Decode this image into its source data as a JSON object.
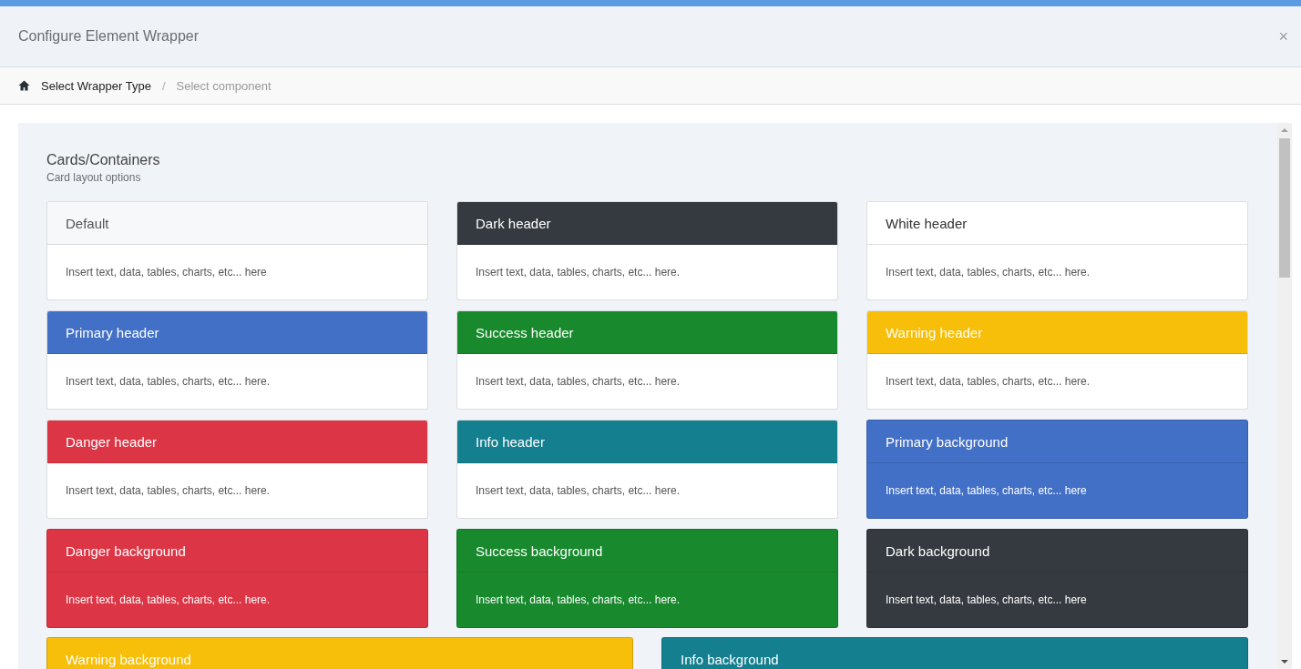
{
  "window": {
    "title": "Configure Element Wrapper",
    "close": "×"
  },
  "breadcrumb_separator": "/",
  "breadcrumb": [
    {
      "label": "Select Wrapper Type",
      "selected": false
    },
    {
      "label": "Select component",
      "selected": true
    }
  ],
  "section": {
    "title": "Cards/Containers",
    "subtitle": "Card layout options"
  },
  "cards": [
    {
      "title": "Default",
      "body": "Insert text, data, tables, charts, etc... here",
      "kind": "default",
      "color": "#f7f8fa"
    },
    {
      "title": "Dark header",
      "body": "Insert text, data, tables, charts, etc... here.",
      "kind": "header",
      "color": "#343a40"
    },
    {
      "title": "White header",
      "body": "Insert text, data, tables, charts, etc... here.",
      "kind": "header",
      "color": "#ffffff"
    },
    {
      "title": "Primary header",
      "body": "Insert text, data, tables, charts, etc... here.",
      "kind": "header",
      "color": "#4270c6"
    },
    {
      "title": "Success header",
      "body": "Insert text, data, tables, charts, etc... here.",
      "kind": "header",
      "color": "#18892d"
    },
    {
      "title": "Warning header",
      "body": "Insert text, data, tables, charts, etc... here.",
      "kind": "header",
      "color": "#f7be0a"
    },
    {
      "title": "Danger header",
      "body": "Insert text, data, tables, charts, etc... here.",
      "kind": "header",
      "color": "#dc3545"
    },
    {
      "title": "Info header",
      "body": "Insert text, data, tables, charts, etc... here.",
      "kind": "header",
      "color": "#137f8f"
    },
    {
      "title": "Primary background",
      "body": "Insert text, data, tables, charts, etc... here",
      "kind": "background",
      "color": "#4270c6"
    },
    {
      "title": "Danger background",
      "body": "Insert text, data, tables, charts, etc... here.",
      "kind": "background",
      "color": "#dc3545"
    },
    {
      "title": "Success background",
      "body": "Insert text, data, tables, charts, etc... here.",
      "kind": "background",
      "color": "#18892d"
    },
    {
      "title": "Dark background",
      "body": "Insert text, data, tables, charts, etc... here",
      "kind": "background",
      "color": "#343a40"
    }
  ],
  "wide_cards": [
    {
      "title": "Warning background",
      "kind": "background",
      "color": "#f7be0a"
    },
    {
      "title": "Info background",
      "kind": "background",
      "color": "#137f8f"
    }
  ]
}
